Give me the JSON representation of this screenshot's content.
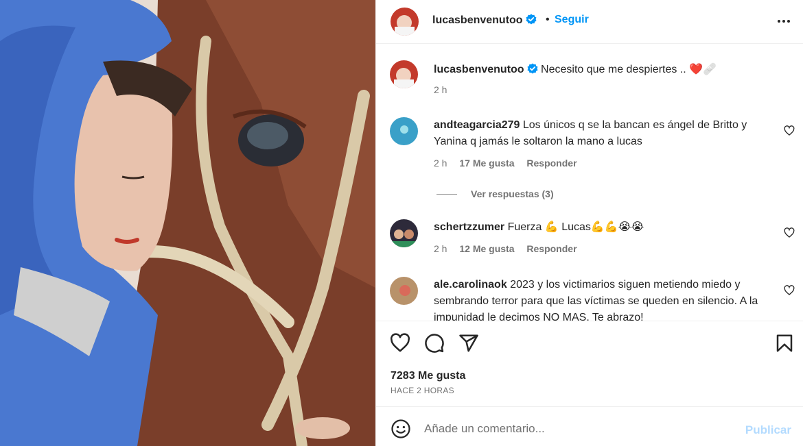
{
  "post": {
    "username": "lucasbenvenutoo",
    "follow_label": "Seguir",
    "separator": "•",
    "caption": "Necesito que me despiertes ..",
    "caption_emojis": "❤️🩹",
    "caption_time": "2 h"
  },
  "comments": [
    {
      "username": "andteagarcia279",
      "text": "Los únicos q se la bancan es ángel de Britto y Yanina q jamás le soltaron la mano a lucas",
      "time": "2 h",
      "likes": "17 Me gusta",
      "reply_label": "Responder",
      "view_replies": "Ver respuestas (3)"
    },
    {
      "username": "schertzzumer",
      "text": "Fuerza 💪 Lucas💪💪😭😭",
      "time": "2 h",
      "likes": "12 Me gusta",
      "reply_label": "Responder"
    },
    {
      "username": "ale.carolinaok",
      "text": "2023 y los victimarios siguen metiendo miedo y sembrando terror para que las víctimas se queden en silencio. A la impunidad le decimos NO MAS. Te abrazo!"
    }
  ],
  "footer": {
    "likes_count": "7283 Me gusta",
    "posted_ago": "HACE 2 HORAS",
    "comment_placeholder": "Añade un comentario...",
    "publish_label": "Publicar"
  },
  "icons": {
    "verified": "verified-badge-icon",
    "more": "more-options-icon",
    "like": "heart-icon",
    "comment": "comment-icon",
    "share": "paper-plane-icon",
    "save": "bookmark-icon",
    "emoji": "emoji-icon"
  },
  "colors": {
    "accent": "#0095f6",
    "verified": "#0095f6",
    "muted": "#737373",
    "publish_disabled": "#b3dbff"
  }
}
